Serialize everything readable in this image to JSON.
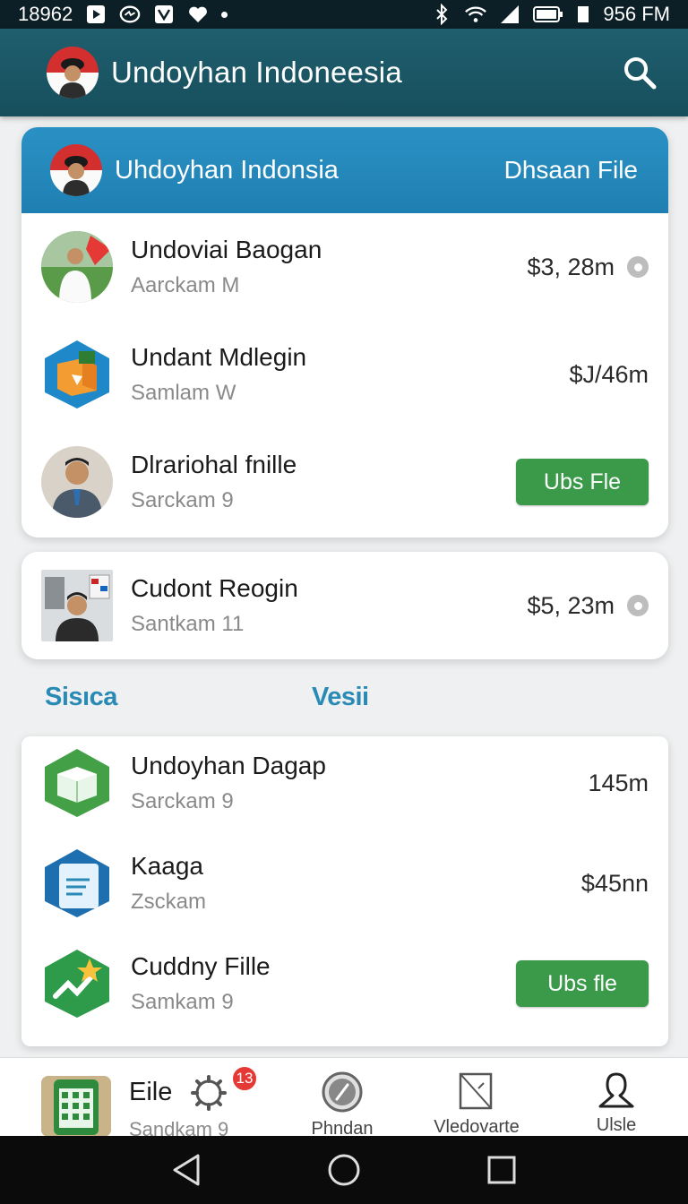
{
  "status_bar": {
    "left_text": "18962",
    "time": "956 FM",
    "icons": [
      "play-icon",
      "messenger-icon",
      "app-icon",
      "heart-icon",
      "dot-icon",
      "bluetooth-icon",
      "wifi-icon",
      "signal-icon",
      "battery-icon",
      "sim-icon"
    ]
  },
  "app_bar": {
    "title": "Undoyhan Indoneesia",
    "search_icon": "search-icon"
  },
  "card1": {
    "header": {
      "title": "Uhdoyhan Indonsia",
      "action": "Dhsaan File"
    },
    "rows": [
      {
        "title": "Undoviai Baogan",
        "subtitle": "Aarckam M",
        "value": "$3, 28m",
        "thumb": "person-photo"
      },
      {
        "title": "Undant Mdlegin",
        "subtitle": "Samlam W",
        "value": "$J/46m",
        "thumb": "box-app-icon"
      },
      {
        "title": "Dlrariohal fnille",
        "subtitle": "Sarckam 9",
        "button": "Ubs Fle",
        "thumb": "man-photo"
      }
    ]
  },
  "card2": {
    "row": {
      "title": "Cudont Reogin",
      "subtitle": "Santkam 11",
      "value": "$5, 23m",
      "thumb": "office-photo"
    }
  },
  "section_tabs": {
    "left": "Sisıca",
    "middle": "Vesii"
  },
  "card3": {
    "rows": [
      {
        "title": "Undoyhan Dagap",
        "subtitle": "Sarckam 9",
        "value": "145m",
        "thumb": "green-box-icon"
      },
      {
        "title": "Kaaga",
        "subtitle": "Zsckam",
        "value": "$45nn",
        "thumb": "document-icon"
      },
      {
        "title": "Cuddny Fille",
        "subtitle": "Samkam 9",
        "button": "Ubs fle",
        "thumb": "chart-star-icon"
      }
    ]
  },
  "bottom_nav": {
    "first": {
      "title": "Eile",
      "subtitle": "Sandkam 9",
      "badge": "13"
    },
    "items": [
      {
        "label": "Phndan",
        "icon": "compass-icon"
      },
      {
        "label": "Vledovarte",
        "icon": "document-slash-icon"
      },
      {
        "label": "Ulsle",
        "icon": "person-icon"
      }
    ]
  },
  "colors": {
    "app_bar": "#1f5f6e",
    "card_header": "#2a91c4",
    "green_button": "#3a9a4a",
    "tab_accent": "#2a8ab6"
  }
}
